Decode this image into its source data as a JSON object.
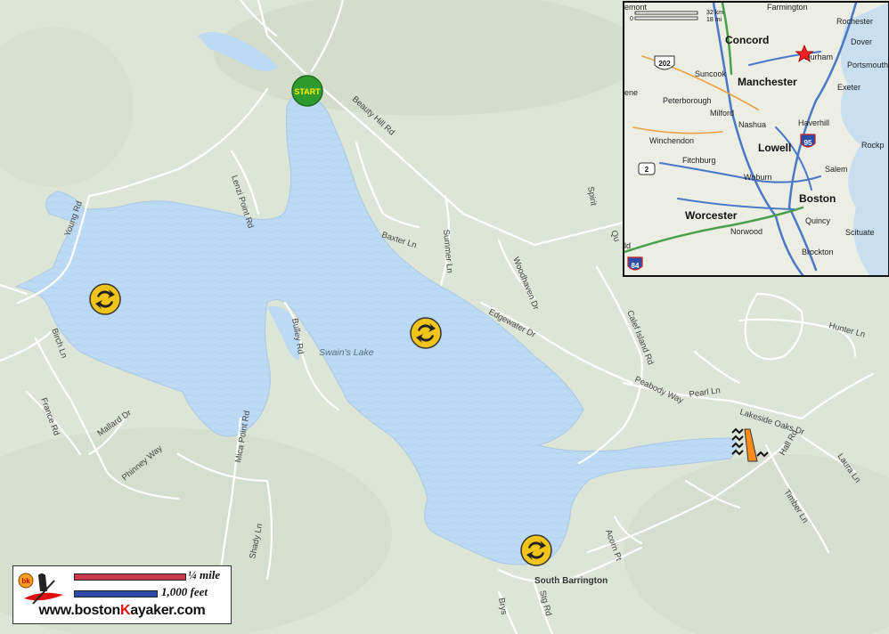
{
  "map": {
    "lake_name": "Swain's Lake",
    "start_label": "START",
    "place_label": "South Barrington",
    "roads": [
      "Beauty Hill Rd",
      "Lenzi Point Rd",
      "Young Rd",
      "Baxter Ln",
      "Summer Ln",
      "Woodhaven Dr",
      "Edgewater Dr",
      "Calef Island Rd",
      "Spirit",
      "Qu",
      "Birch Ln",
      "France Rd",
      "Mallard Dr",
      "Phinney Way",
      "Bulley Rd",
      "Mica Point Rd",
      "Shady Ln",
      "Peabody Way",
      "Pearl Ln",
      "Hunter Ln",
      "Lakeside Oaks Dr",
      "Hall Rd",
      "Laura Ln",
      "Timber Ln",
      "Acorn Pt",
      "Stg Rd",
      "Brys"
    ],
    "colors": {
      "water": "#bfdcf5",
      "land": "#dfe6d8",
      "start": "#2e9a2e",
      "poi": "#f0c419"
    }
  },
  "inset": {
    "scale_km": "32 km",
    "scale_mi": "18 mi",
    "scale_zero": "0",
    "cities": {
      "farmington": "Farmington",
      "rochester": "Rochester",
      "concord": "Concord",
      "dover": "Dover",
      "durham": "Durham",
      "portsmouth": "Portsmouth",
      "suncook": "Suncook",
      "manchester": "Manchester",
      "exeter": "Exeter",
      "peterborough": "Peterborough",
      "milford": "Milford",
      "nashua": "Nashua",
      "haverhill": "Haverhill",
      "winchendon": "Winchendon",
      "lowell": "Lowell",
      "rockport": "Rockp",
      "fitchburg": "Fitchburg",
      "salem": "Salem",
      "woburn": "Woburn",
      "boston": "Boston",
      "worcester": "Worcester",
      "quincy": "Quincy",
      "norwood": "Norwood",
      "scituate": "Scituate",
      "brockton": "Brockton",
      "ene": "ene",
      "ld": "ld",
      "emont": "emont"
    },
    "shields": {
      "us202": "202",
      "i95": "95",
      "rt2": "2",
      "i84": "84"
    }
  },
  "legend": {
    "quarter_mile": "¼ mile",
    "thousand_feet": "1,000 feet",
    "site_prefix": "www.boston",
    "site_k": "K",
    "site_suffix": "ayaker.com",
    "logo_text": "bk"
  }
}
